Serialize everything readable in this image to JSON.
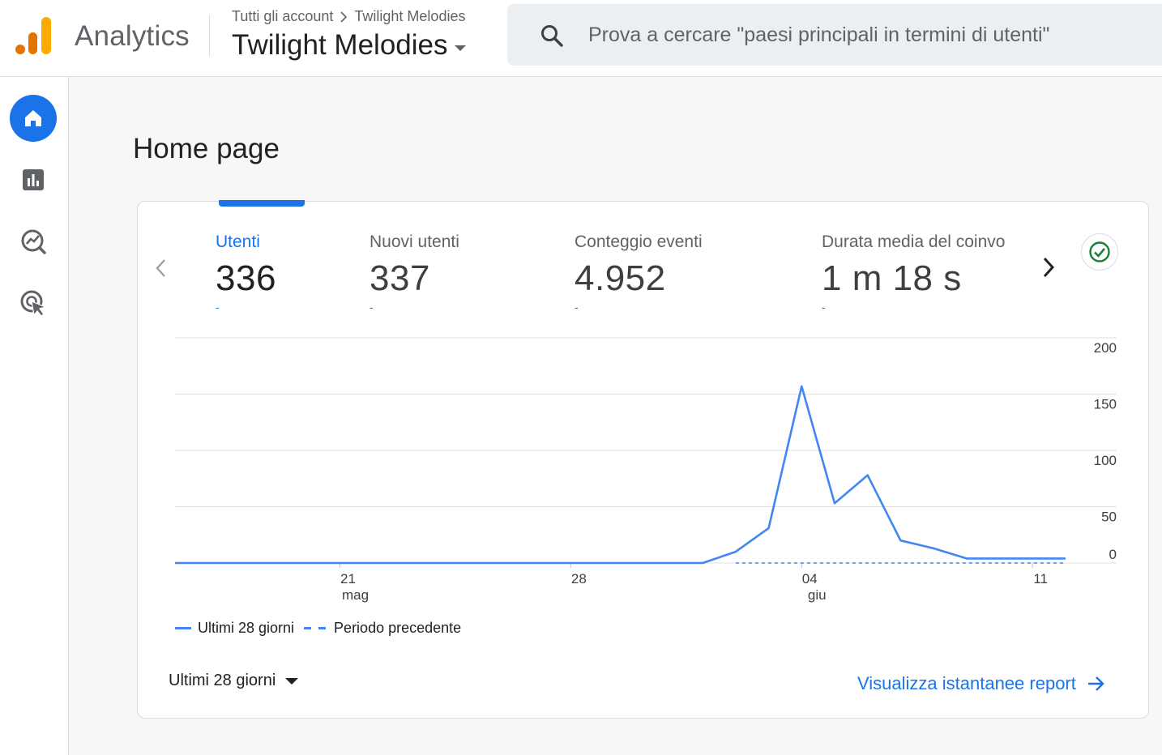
{
  "header": {
    "product_name": "Analytics",
    "breadcrumb": {
      "account": "Tutti gli account",
      "property": "Twilight Melodies"
    },
    "property_name": "Twilight Melodies",
    "logo_colors": [
      "#f9ab00",
      "#e37400"
    ]
  },
  "search": {
    "placeholder": "Prova a cercare \"paesi principali in termini di utenti\""
  },
  "sidebar": {
    "items": [
      {
        "name": "home-icon",
        "active": true
      },
      {
        "name": "reports-icon",
        "active": false
      },
      {
        "name": "explore-icon",
        "active": false
      },
      {
        "name": "advertising-icon",
        "active": false
      }
    ],
    "accent": "#1a73e8"
  },
  "page": {
    "title": "Home page"
  },
  "metrics": [
    {
      "label": "Utenti",
      "value": "336",
      "delta": "-",
      "active": true
    },
    {
      "label": "Nuovi utenti",
      "value": "337",
      "delta": "-",
      "active": false
    },
    {
      "label": "Conteggio eventi",
      "value": "4.952",
      "delta": "-",
      "active": false
    },
    {
      "label": "Durata media del coinvo",
      "value": "1 m 18 s",
      "delta": "-",
      "active": false
    }
  ],
  "chart_data": {
    "type": "line",
    "x_ticks": [
      {
        "day": 21,
        "label": "21",
        "sublabel": "mag"
      },
      {
        "day": 28,
        "label": "28",
        "sublabel": ""
      },
      {
        "day": 35,
        "label": "04",
        "sublabel": "giu"
      },
      {
        "day": 42,
        "label": "11",
        "sublabel": ""
      }
    ],
    "y_ticks": [
      0,
      50,
      100,
      150,
      200
    ],
    "ylim": [
      0,
      200
    ],
    "xlim": [
      16,
      43.2
    ],
    "grid": true,
    "series": [
      {
        "name": "Ultimi 28 giorni",
        "style": "solid",
        "color": "#4285f4",
        "x": [
          16,
          17,
          18,
          19,
          20,
          21,
          22,
          23,
          24,
          25,
          26,
          27,
          28,
          29,
          30,
          31,
          32,
          33,
          34,
          35,
          36,
          37,
          38,
          39,
          40,
          41,
          42,
          43
        ],
        "values": [
          0,
          0,
          0,
          0,
          0,
          0,
          0,
          0,
          0,
          0,
          0,
          0,
          0,
          0,
          0,
          0,
          0,
          10,
          31,
          157,
          53,
          78,
          20,
          13,
          4,
          4,
          4,
          4
        ]
      },
      {
        "name": "Periodo precedente",
        "style": "dashed",
        "color": "#4285f4",
        "x": [
          33,
          34,
          35,
          36,
          37,
          38,
          39,
          40,
          41,
          42,
          43
        ],
        "values": [
          0,
          0,
          0,
          0,
          0,
          0,
          0,
          0,
          0,
          0,
          0
        ]
      }
    ],
    "legend": {
      "placement": "bottom-left",
      "items": [
        "Ultimi 28 giorni",
        "Periodo precedente"
      ]
    }
  },
  "footer": {
    "range_label": "Ultimi 28 giorni",
    "report_link": "Visualizza istantanee report"
  }
}
